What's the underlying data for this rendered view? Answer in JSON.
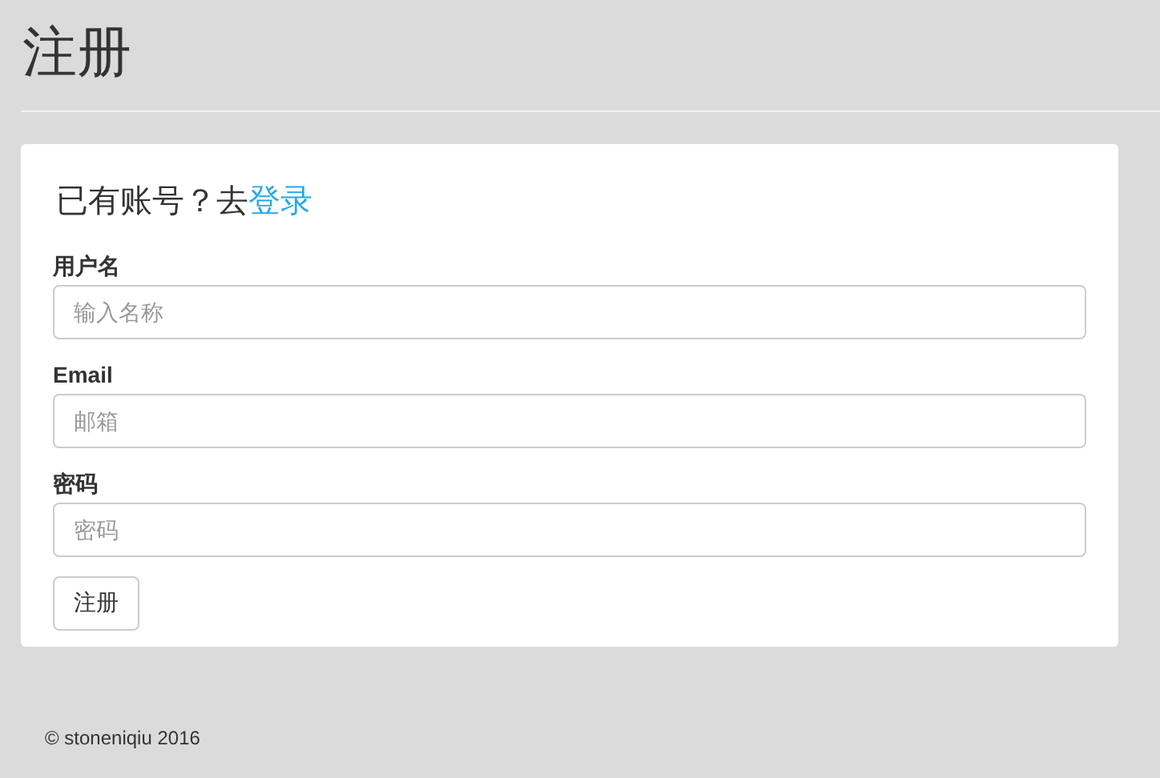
{
  "page_title": "注册",
  "login_prompt": {
    "text": "已有账号？去",
    "link": "登录"
  },
  "fields": [
    {
      "label": "用户名",
      "placeholder": "输入名称"
    },
    {
      "label": "Email",
      "placeholder": "邮箱"
    },
    {
      "label": "密码",
      "placeholder": "密码"
    }
  ],
  "submit_button": "注册",
  "footer": "© stoneniqiu 2016"
}
